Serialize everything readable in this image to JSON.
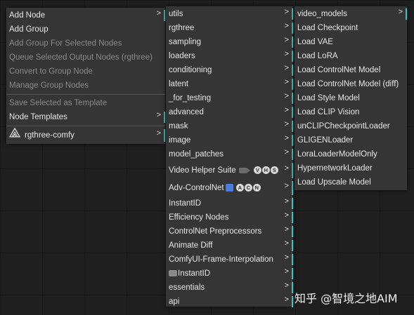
{
  "context_menu": {
    "add_node": "Add Node",
    "add_group": "Add Group",
    "add_group_selected": "Add Group For Selected Nodes",
    "queue_selected": "Queue Selected Output Nodes (rgthree)",
    "convert_group": "Convert to Group Node",
    "manage_group": "Manage Group Nodes",
    "save_template": "Save Selected as Template",
    "node_templates": "Node Templates",
    "rgthree_comfy": "rgthree-comfy",
    "submenu_arrow": ">"
  },
  "category_menu": {
    "items": [
      "utils",
      "rgthree",
      "sampling",
      "loaders",
      "conditioning",
      "latent",
      "_for_testing",
      "advanced",
      "mask",
      "image",
      "model_patches",
      "Video Helper Suite",
      "Adv-ControlNet",
      "InstantID",
      "Efficiency Nodes",
      "ControlNet Preprocessors",
      "Animate Diff",
      "ComfyUI-Frame-Interpolation",
      "InstantID",
      "essentials",
      "api"
    ],
    "vhs_badge": [
      "V",
      "H",
      "S"
    ],
    "acn_badge": [
      "A",
      "C",
      "N"
    ]
  },
  "loaders_menu": {
    "items": [
      "video_models",
      "Load Checkpoint",
      "Load VAE",
      "Load LoRA",
      "Load ControlNet Model",
      "Load ControlNet Model (diff)",
      "Load Style Model",
      "Load CLIP Vision",
      "unCLIPCheckpointLoader",
      "GLIGENLoader",
      "LoraLoaderModelOnly",
      "HypernetworkLoader",
      "Load Upscale Model"
    ]
  },
  "watermark": "知乎 @智境之地AIM",
  "colors": {
    "accent": "#2fc7c7",
    "menu_bg": "#353535",
    "canvas_bg": "#1f1f1f"
  }
}
